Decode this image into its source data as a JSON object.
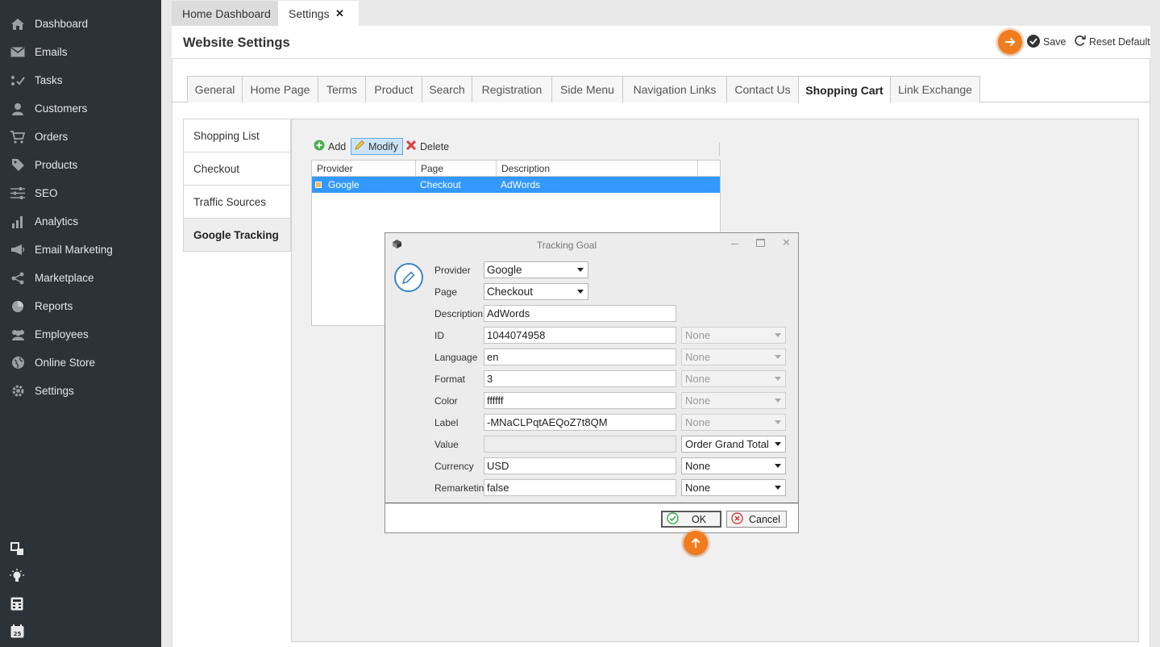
{
  "sidebar": {
    "items": [
      {
        "label": "Dashboard",
        "icon": "home-icon"
      },
      {
        "label": "Emails",
        "icon": "envelope-icon"
      },
      {
        "label": "Tasks",
        "icon": "tasks-icon"
      },
      {
        "label": "Customers",
        "icon": "user-icon"
      },
      {
        "label": "Orders",
        "icon": "cart-icon"
      },
      {
        "label": "Products",
        "icon": "tag-icon"
      },
      {
        "label": "SEO",
        "icon": "sliders-icon"
      },
      {
        "label": "Analytics",
        "icon": "bar-chart-icon"
      },
      {
        "label": "Email Marketing",
        "icon": "megaphone-icon"
      },
      {
        "label": "Marketplace",
        "icon": "share-icon"
      },
      {
        "label": "Reports",
        "icon": "pie-chart-icon"
      },
      {
        "label": "Employees",
        "icon": "users-icon"
      },
      {
        "label": "Online Store",
        "icon": "globe-icon"
      },
      {
        "label": "Settings",
        "icon": "gear-icon"
      }
    ],
    "bottom_icons": [
      "windows-icon",
      "lightbulb-icon",
      "calculator-icon",
      "calendar-icon"
    ],
    "calendar_day": "25"
  },
  "doc_tabs": [
    {
      "label": "Home Dashboard"
    },
    {
      "label": "Settings",
      "close": "✕"
    }
  ],
  "header": {
    "title": "Website Settings",
    "save_label": "Save",
    "reset_label": "Reset Default"
  },
  "tabs": [
    "General",
    "Home Page",
    "Terms",
    "Product",
    "Search",
    "Registration",
    "Side Menu",
    "Navigation Links",
    "Contact Us",
    "Shopping Cart",
    "Link Exchange"
  ],
  "active_tab": "Shopping Cart",
  "vertical_tabs": [
    "Shopping List",
    "Checkout",
    "Traffic Sources",
    "Google Tracking"
  ],
  "active_vertical_tab": "Google Tracking",
  "toolbar": {
    "add": "Add",
    "modify": "Modify",
    "delete": "Delete"
  },
  "grid": {
    "columns": [
      "Provider",
      "Page",
      "Description"
    ],
    "rows": [
      {
        "provider": "Google",
        "page": "Checkout",
        "description": "AdWords"
      }
    ]
  },
  "dialog": {
    "title": "Tracking Goal",
    "fields": {
      "provider": {
        "label": "Provider",
        "value": "Google"
      },
      "page": {
        "label": "Page",
        "value": "Checkout"
      },
      "description": {
        "label": "Description",
        "value": "AdWords"
      },
      "id": {
        "label": "ID",
        "value": "1044074958",
        "select": "None"
      },
      "language": {
        "label": "Language",
        "value": "en",
        "select": "None"
      },
      "format": {
        "label": "Format",
        "value": "3",
        "select": "None"
      },
      "color": {
        "label": "Color",
        "value": "ffffff",
        "select": "None"
      },
      "label": {
        "label": "Label",
        "value": "-MNaCLPqtAEQoZ7t8QM",
        "select": "None"
      },
      "value": {
        "label": "Value",
        "value": "",
        "select": "Order Grand Total"
      },
      "currency": {
        "label": "Currency",
        "value": "USD",
        "select": "None"
      },
      "remarketing": {
        "label": "Remarketing",
        "value": "false",
        "select": "None"
      }
    },
    "ok_label": "OK",
    "cancel_label": "Cancel"
  },
  "colors": {
    "sidebar_bg": "#2d3238",
    "accent_orange": "#f07c1e",
    "selection_blue": "#3399ff"
  }
}
